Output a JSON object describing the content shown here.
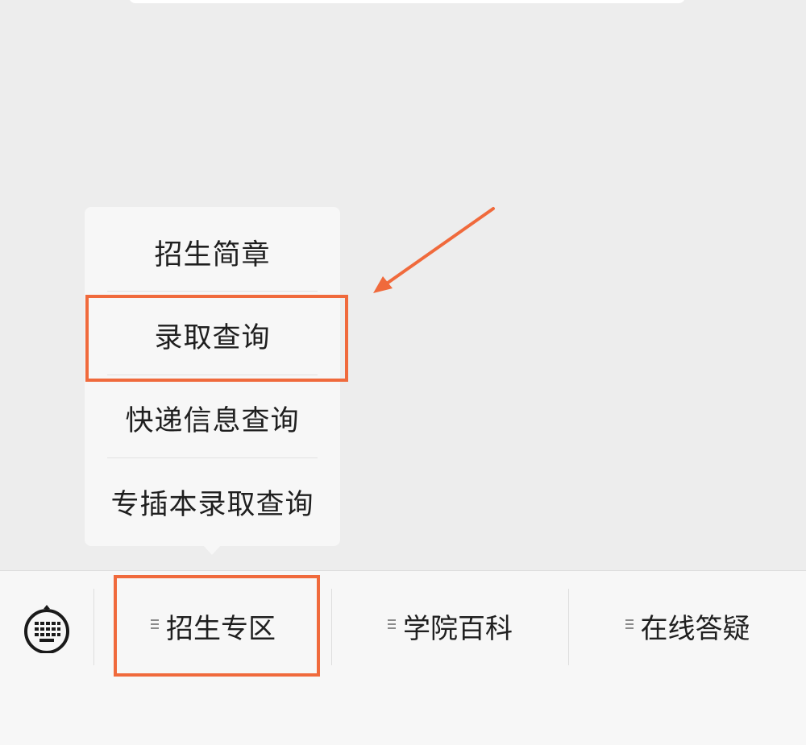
{
  "popup_menu": {
    "items": [
      {
        "label": "招生简章"
      },
      {
        "label": "录取查询"
      },
      {
        "label": "快递信息查询"
      },
      {
        "label": "专插本录取查询"
      }
    ],
    "highlighted_item": "录取查询"
  },
  "bottom_bar": {
    "keyboard_icon": "keyboard-icon",
    "tabs": [
      {
        "label": "招生专区"
      },
      {
        "label": "学院百科"
      },
      {
        "label": "在线答疑"
      }
    ],
    "highlighted_tab": "招生专区"
  },
  "colors": {
    "highlight": "#f06a3c",
    "background": "#ededed",
    "bar": "#f7f7f7"
  }
}
